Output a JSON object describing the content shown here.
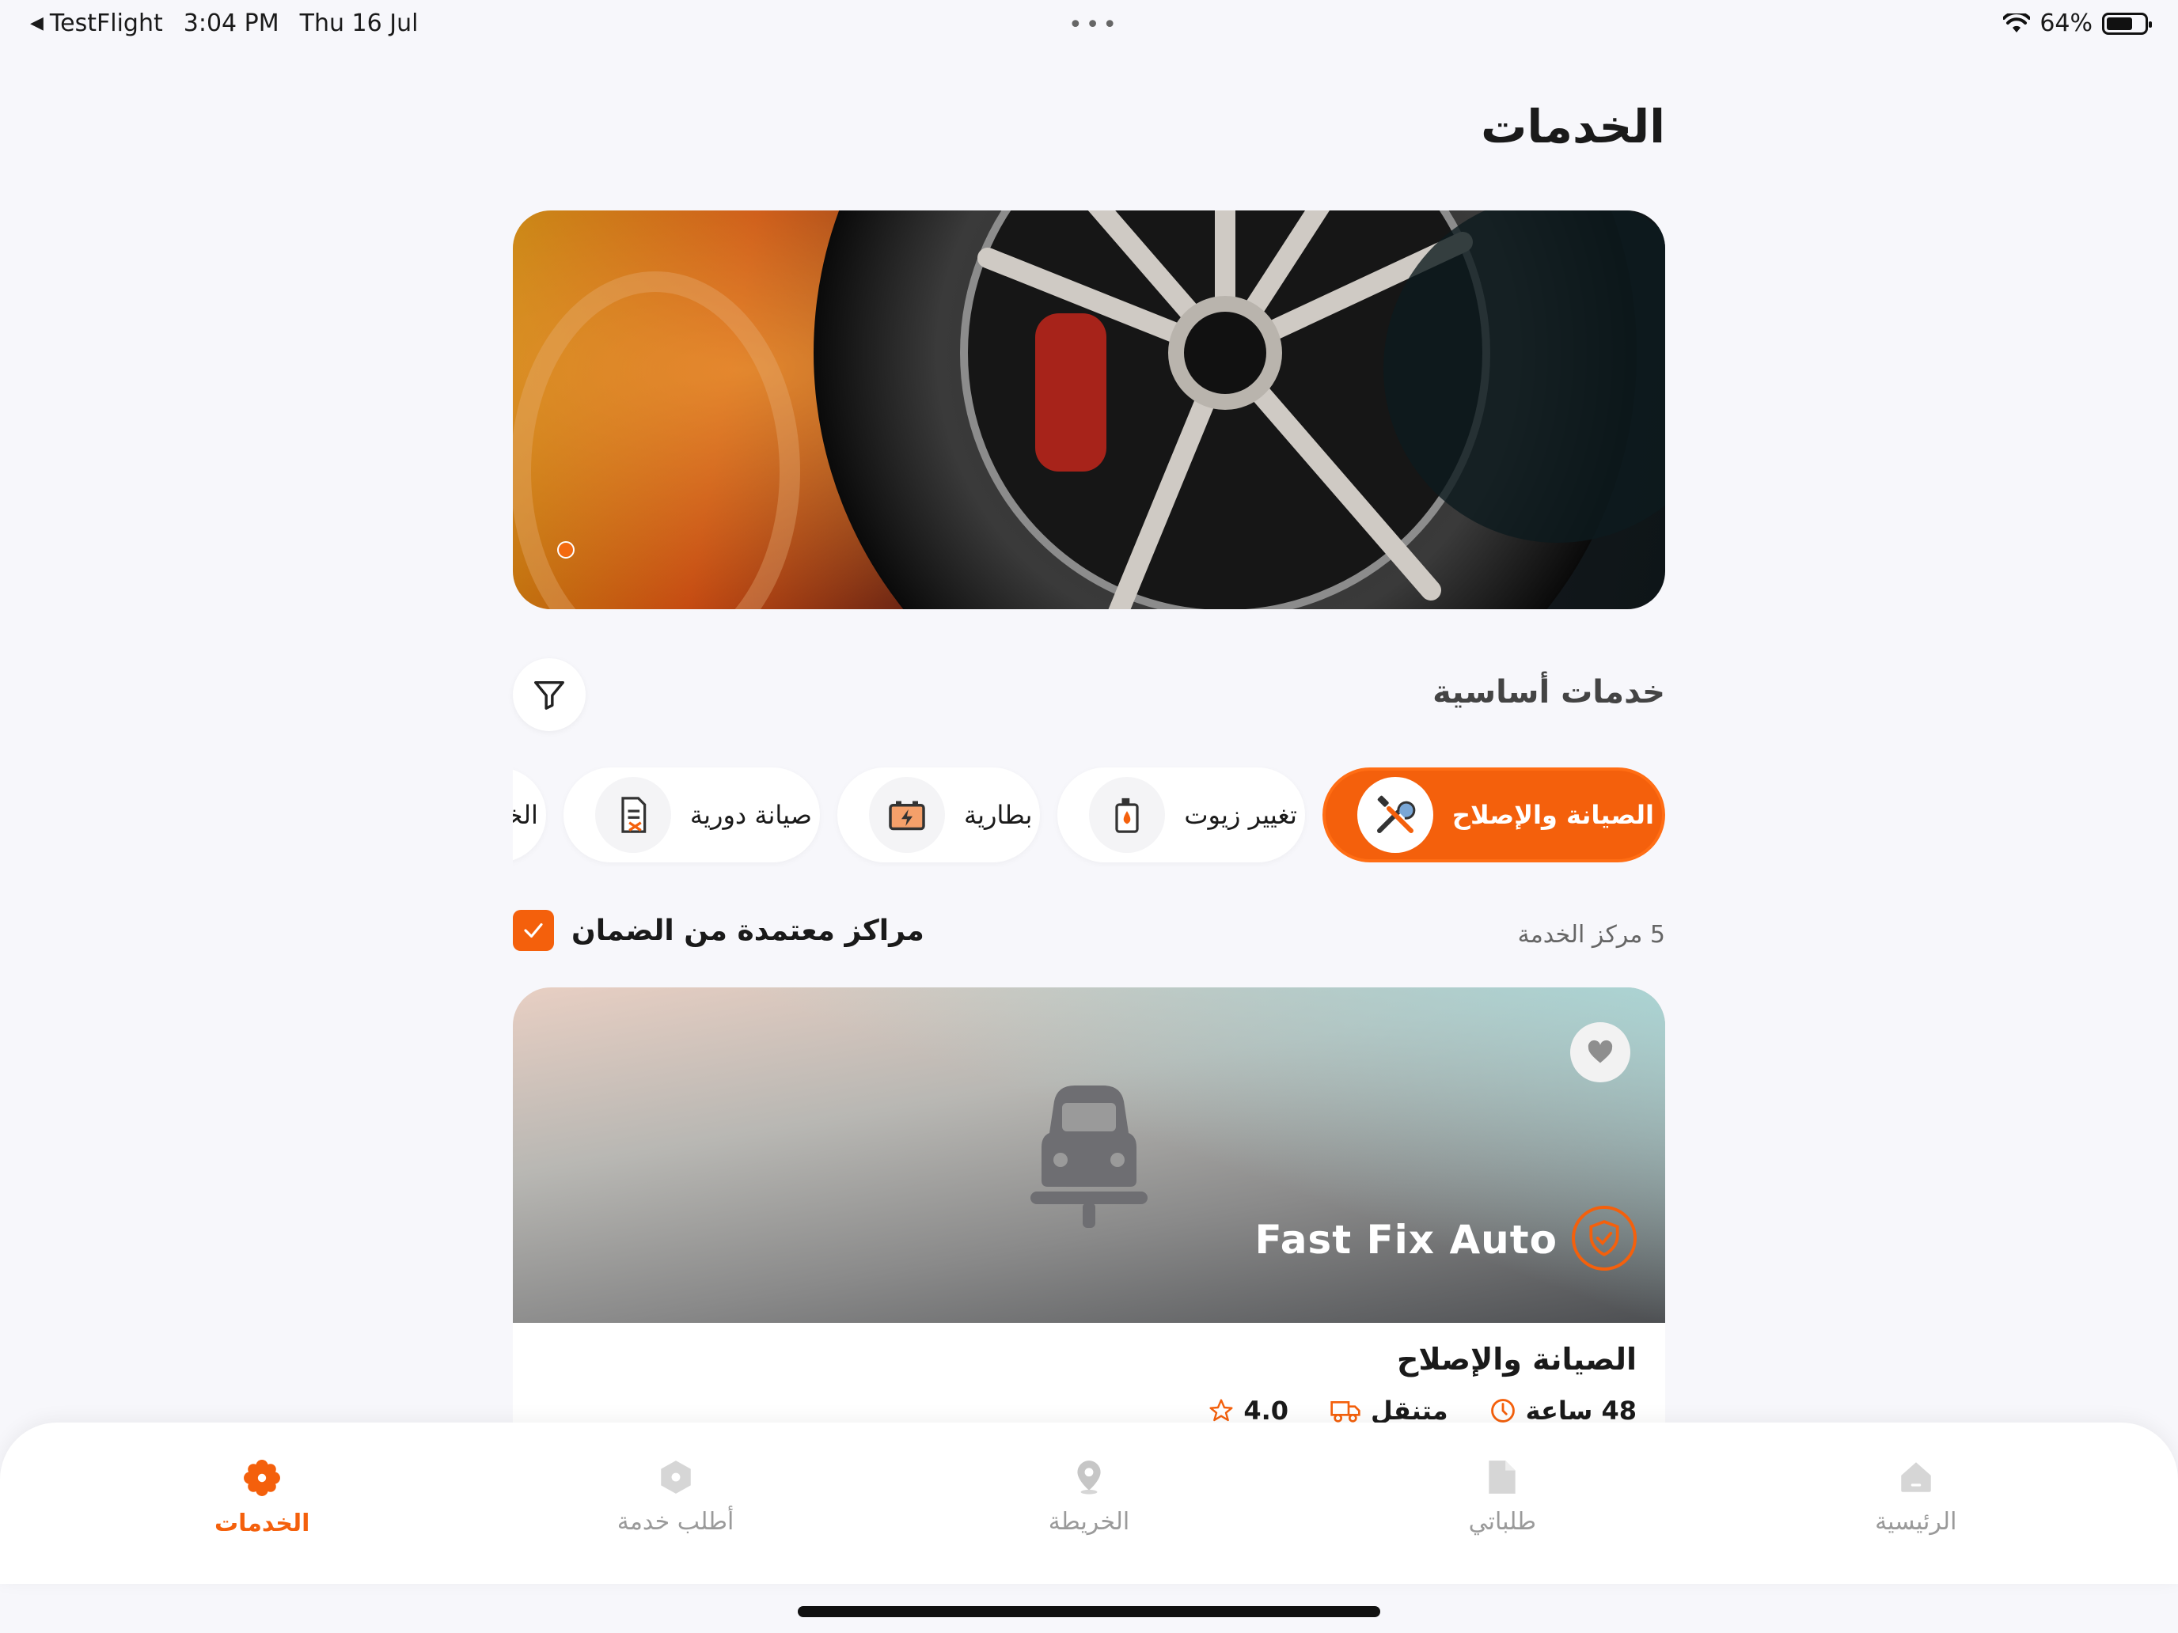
{
  "status_bar": {
    "back_app": "TestFlight",
    "time": "3:04 PM",
    "date": "Thu 16 Jul",
    "battery": "64%"
  },
  "page": {
    "title": "الخدمات"
  },
  "banner": {
    "slide_count": 1,
    "active_slide": 1
  },
  "section": {
    "title": "خدمات أساسية"
  },
  "categories": [
    {
      "label": "الصيانة والإصلاح",
      "icon": "wrench-screwdriver-icon",
      "active": true
    },
    {
      "label": "تغيير زيوت",
      "icon": "oil-can-icon",
      "active": false
    },
    {
      "label": "بطارية",
      "icon": "battery-icon",
      "active": false
    },
    {
      "label": "صيانة دورية",
      "icon": "checklist-icon",
      "active": false
    },
    {
      "label": "الخد",
      "icon": "tow-truck-icon",
      "active": false
    }
  ],
  "results": {
    "count_text": "5 مركز الخدمة",
    "warranty_filter_label": "مراكز معتمدة من الضمان",
    "warranty_filter_checked": true
  },
  "card": {
    "name": "Fast Fix Auto",
    "category": "الصيانة والإصلاح",
    "rating": "4.0",
    "mobility": "متنقل",
    "duration": "48 ساعة",
    "favorite": false,
    "verified": true
  },
  "nav": {
    "items": [
      {
        "label": "الرئيسية",
        "icon": "home-icon",
        "active": false
      },
      {
        "label": "طلباتي",
        "icon": "document-icon",
        "active": false
      },
      {
        "label": "الخريطة",
        "icon": "map-pin-icon",
        "active": false
      },
      {
        "label": "أطلب خدمة",
        "icon": "hexagon-icon",
        "active": false
      },
      {
        "label": "الخدمات",
        "icon": "gear-flower-icon",
        "active": true
      }
    ]
  },
  "colors": {
    "accent": "#f4600c",
    "background": "#f7f7fb",
    "inactive": "#9a9a9a"
  }
}
